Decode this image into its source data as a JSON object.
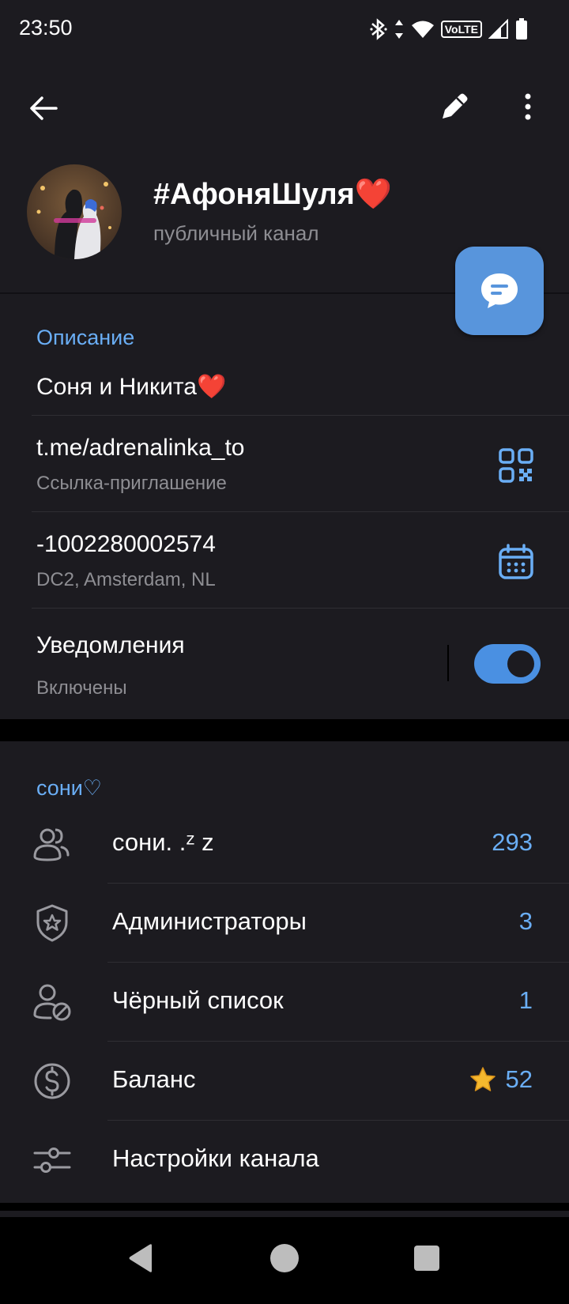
{
  "status_bar": {
    "time": "23:50",
    "network_label": "VoLTE",
    "icons": [
      "bluetooth-icon",
      "data-arrows-icon",
      "wifi-icon",
      "signal-icon",
      "battery-icon"
    ]
  },
  "toolbar": {
    "back_icon": "arrow-left-icon",
    "edit_icon": "pencil-icon",
    "more_icon": "more-vertical-icon"
  },
  "profile": {
    "title": "#АфоняШуля❤️",
    "subtitle": "публичный канал"
  },
  "fab": {
    "icon": "chat-bubble-icon"
  },
  "info": {
    "description_header": "Описание",
    "description_text": "Соня и Никита❤️",
    "link": {
      "value": "t.me/adrenalinka_to",
      "label": "Ссылка-приглашение",
      "icon": "qr-code-icon"
    },
    "id": {
      "value": "-1002280002574",
      "label": "DC2, Amsterdam, NL",
      "icon": "calendar-icon"
    },
    "notifications": {
      "title": "Уведомления",
      "status": "Включены",
      "enabled": true
    }
  },
  "group": {
    "header": "сони♡",
    "rows": [
      {
        "icon": "users-icon",
        "label": "сони. .ᶻ z",
        "value": "293"
      },
      {
        "icon": "shield-star-icon",
        "label": "Администраторы",
        "value": "3"
      },
      {
        "icon": "user-blocked-icon",
        "label": "Чёрный список",
        "value": "1"
      },
      {
        "icon": "dollar-circle-icon",
        "label": "Баланс",
        "value": "52",
        "value_icon": "star-icon"
      },
      {
        "icon": "sliders-icon",
        "label": "Настройки канала",
        "value": ""
      }
    ]
  },
  "colors": {
    "background": "#1c1b20",
    "accent": "#6aaef5",
    "fab": "#5895dc",
    "toggle_on": "#4a90e2",
    "secondary_text": "#8e8e93",
    "star": "#f5b82e"
  }
}
